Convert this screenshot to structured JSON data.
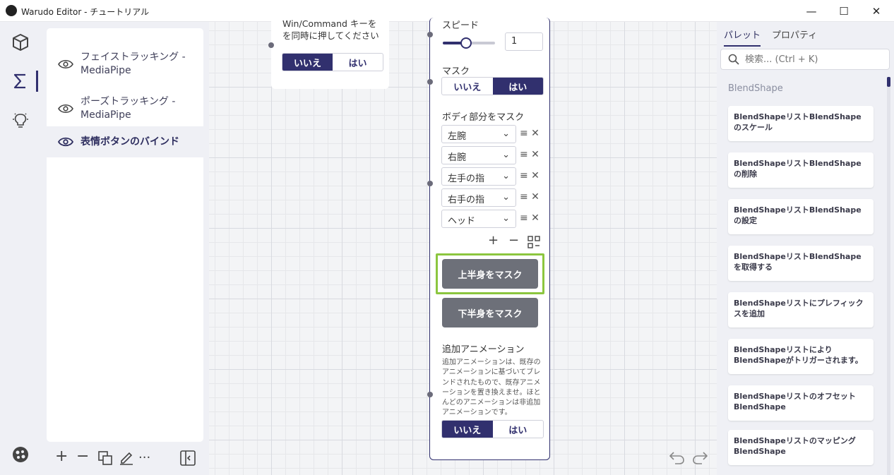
{
  "window": {
    "title": "Warudo Editor - チュートリアル",
    "minimize": "—",
    "maximize": "☐",
    "close": "✕"
  },
  "tree": {
    "items": [
      {
        "label": "フェイストラッキング - MediaPipe",
        "selected": false
      },
      {
        "label": "ポーズトラッキング - MediaPipe",
        "selected": false
      },
      {
        "label": "表情ボタンのバインド",
        "selected": true
      }
    ]
  },
  "toolbar": {
    "add": "+",
    "remove": "−",
    "more": "···"
  },
  "node_left": {
    "text": "Win/Command キーをを同時に押してください",
    "toggle": {
      "no": "いいえ",
      "yes": "はい",
      "value": "no"
    }
  },
  "node_main": {
    "speed_label": "スピード",
    "speed_value": "1",
    "speed_fraction": 0.45,
    "mask_label": "マスク",
    "mask_toggle": {
      "no": "いいえ",
      "yes": "はい",
      "value": "yes"
    },
    "body_mask_label": "ボディ部分をマスク",
    "body_parts": [
      "左腕",
      "右腕",
      "左手の指",
      "右手の指",
      "ヘッド"
    ],
    "list_add": "+",
    "list_remove": "−",
    "upper_button": "上半身をマスク",
    "lower_button": "下半身をマスク",
    "additive_label": "追加アニメーション",
    "additive_desc": "追加アニメーションは、既存のアニメーションに基づいてブレンドされたもので、既存アニメーションを置き換えませ。ほとんどのアニメーションは非追加アニメーションです。",
    "additive_toggle": {
      "no": "いいえ",
      "yes": "はい",
      "value": "no"
    }
  },
  "palette": {
    "tabs": [
      "パレット",
      "プロパティ"
    ],
    "active_tab": "パレット",
    "search_placeholder": "検索... (Ctrl + K)",
    "section": "BlendShape",
    "items": [
      "BlendShapeリストBlendShapeのスケール",
      "BlendShapeリストBlendShapeの削除",
      "BlendShapeリストBlendShapeの設定",
      "BlendShapeリストBlendShapeを取得する",
      "BlendShapeリストにプレフィックスを追加",
      "BlendShapeリストによりBlendShapeがトリガーされます。",
      "BlendShapeリストのオフセットBlendShape",
      "BlendShapeリストのマッピングBlendShape"
    ]
  },
  "colors": {
    "accent": "#31306e",
    "highlight": "#8cc63f",
    "button_gray": "#6d7079"
  }
}
